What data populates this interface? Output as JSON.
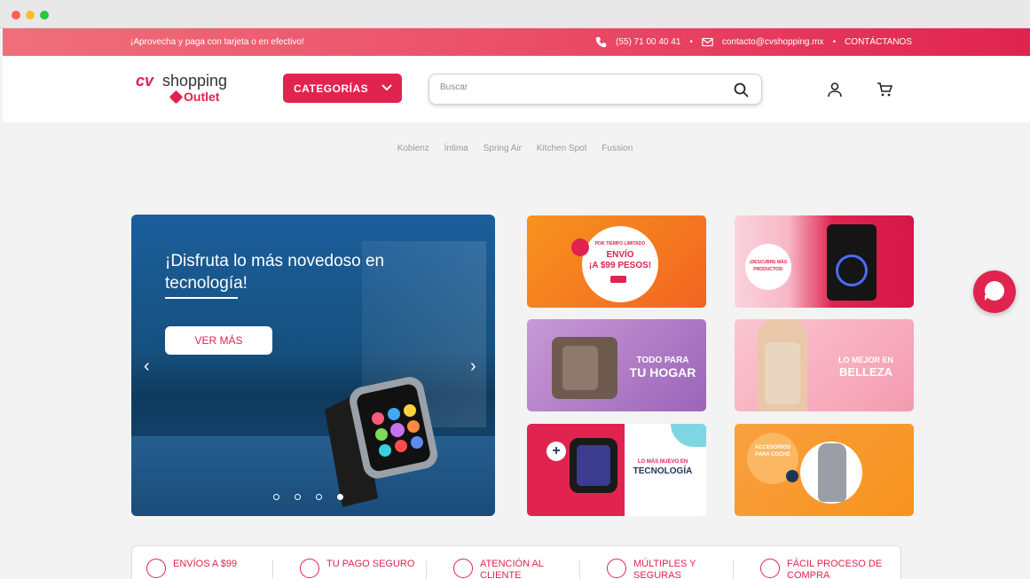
{
  "topbar": {
    "promo": "¡Aprovecha y paga con tarjeta o en efectivo!",
    "phone": "(55) 71 00 40 41",
    "email": "contacto@cvshopping.mx",
    "contact": "CONTÁCTANOS",
    "separator": "•"
  },
  "header": {
    "logo_cv": "cv",
    "logo_shopping": "shopping",
    "logo_outlet": "Outlet",
    "categories_label": "CATEGORÍAS",
    "search_placeholder": "Buscar"
  },
  "brands": [
    "Koblenz",
    "Íntima",
    "Spring Air",
    "Kitchen Spot",
    "Fussion"
  ],
  "hero": {
    "headline_line1": "¡Disfruta lo más novedoso en",
    "headline_line2": "tecnología!",
    "cta": "VER MÁS",
    "prev": "‹",
    "next": "›",
    "slides": 4,
    "active_slide": 4
  },
  "tiles": {
    "envio_top": "POR TIEMPO LIMITADO",
    "envio_line1": "ENVÍO",
    "envio_line2": "¡A $99 PESOS!",
    "descubre_line1": "¡DESCUBRE MÁS",
    "descubre_line2": "PRODUCTOS!",
    "hogar_line1": "TODO PARA",
    "hogar_line2": "TU HOGAR",
    "belleza_line1": "LO MEJOR EN",
    "belleza_line2": "BELLEZA",
    "tecno_line1": "LO MÁS NUEVO EN",
    "tecno_line2": "TECNOLOGÍA",
    "coche_line1": "ACCESORIOS",
    "coche_line2": "PARA COCHE"
  },
  "benefits": [
    {
      "label": "ENVÍOS A $99",
      "sub": ""
    },
    {
      "label": "TU PAGO SEGURO",
      "sub": ""
    },
    {
      "label": "ATENCIÓN AL",
      "sub": "CLIENTE"
    },
    {
      "label": "MÚLTIPLES Y",
      "sub": "SEGURAS"
    },
    {
      "label": "FÁCIL PROCESO DE",
      "sub": "COMPRA"
    }
  ],
  "colors": {
    "brand": "#e0234f",
    "orange": "#f7931e",
    "purple": "#b07cc6",
    "pink": "#f5a3b5"
  }
}
